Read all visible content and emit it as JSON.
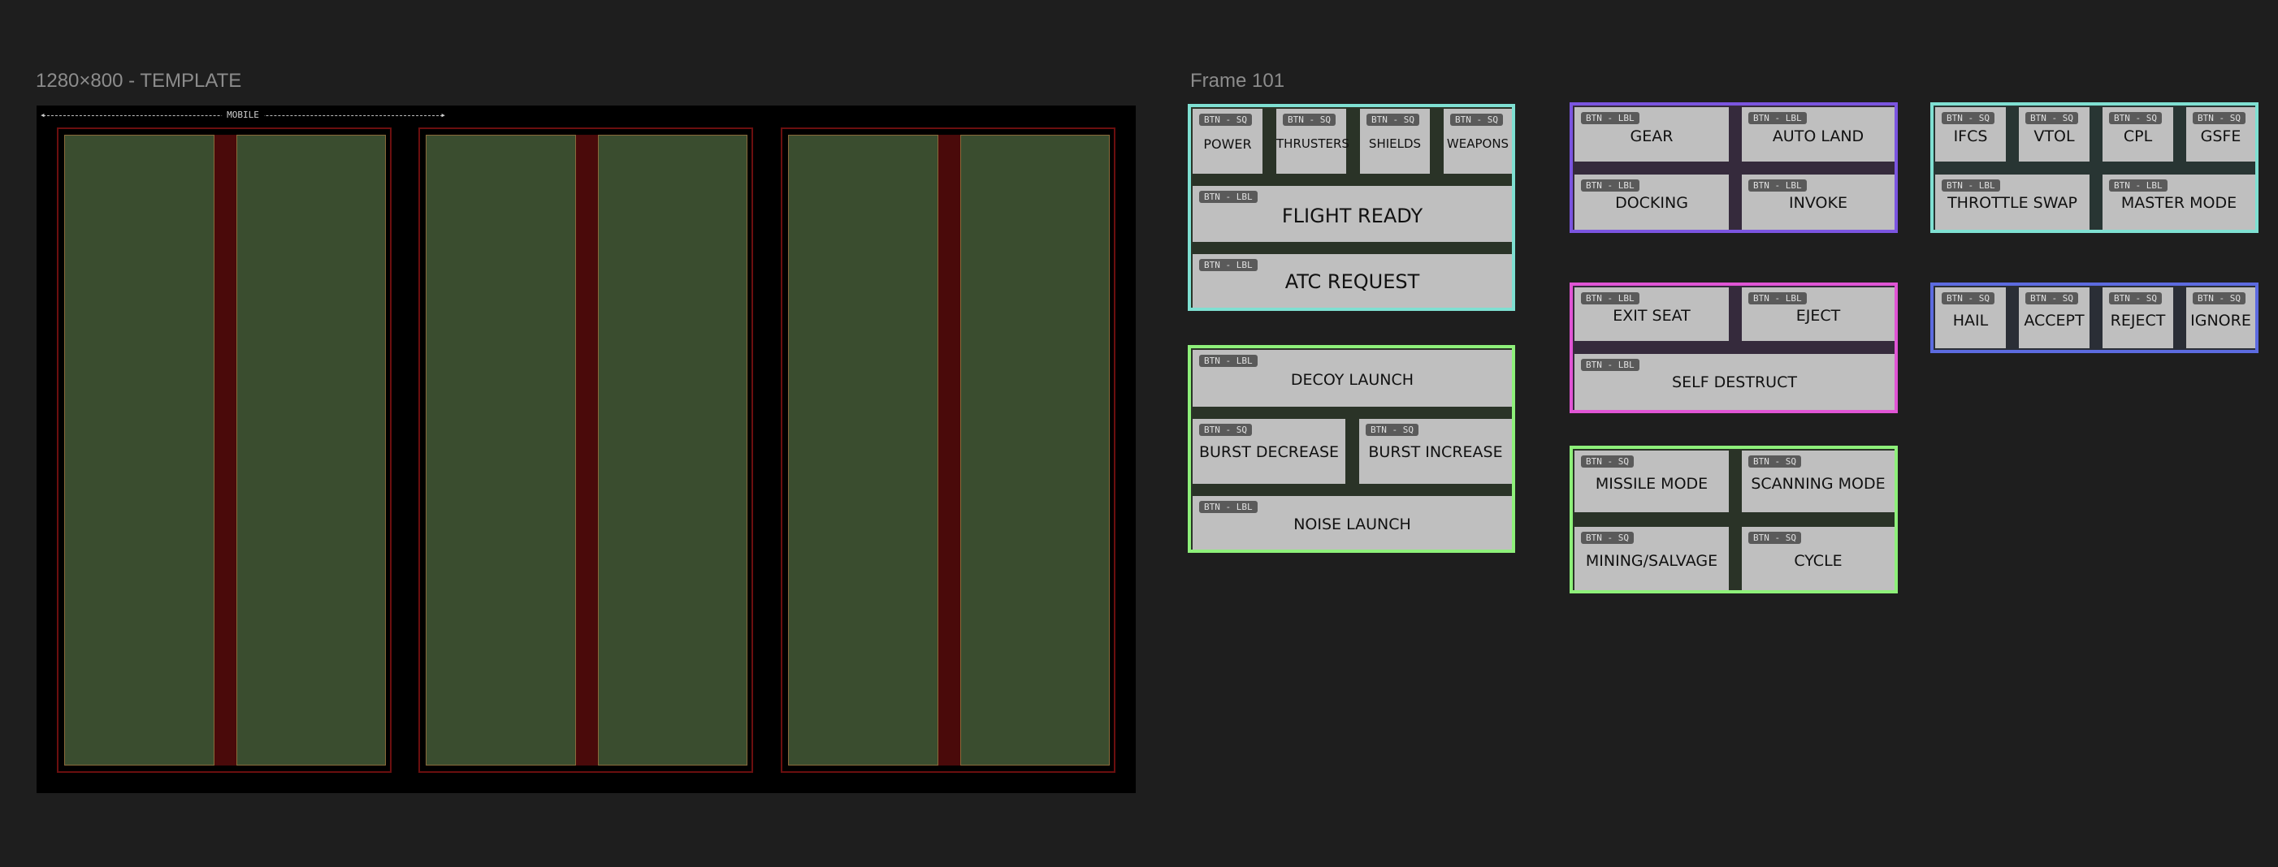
{
  "template": {
    "title": "1280×800 - TEMPLATE",
    "mobile_label": "MOBILE"
  },
  "frame101": {
    "title": "Frame 101"
  },
  "groups": {
    "flight": {
      "row1": [
        {
          "tag": "BTN - SQ",
          "label": "POWER"
        },
        {
          "tag": "BTN - SQ",
          "label": "THRUSTERS"
        },
        {
          "tag": "BTN - SQ",
          "label": "SHIELDS"
        },
        {
          "tag": "BTN - SQ",
          "label": "WEAPONS"
        }
      ],
      "flight_ready": {
        "tag": "BTN - LBL",
        "label": "FLIGHT READY"
      },
      "atc_request": {
        "tag": "BTN - LBL",
        "label": "ATC REQUEST"
      }
    },
    "countermeasures": {
      "decoy": {
        "tag": "BTN - LBL",
        "label": "DECOY LAUNCH"
      },
      "burst_decrease": {
        "tag": "BTN - SQ",
        "label": "BURST DECREASE"
      },
      "burst_increase": {
        "tag": "BTN - SQ",
        "label": "BURST INCREASE"
      },
      "noise": {
        "tag": "BTN - LBL",
        "label": "NOISE LAUNCH"
      }
    },
    "landing": {
      "gear": {
        "tag": "BTN - LBL",
        "label": "GEAR"
      },
      "auto_land": {
        "tag": "BTN - LBL",
        "label": "AUTO LAND"
      },
      "docking": {
        "tag": "BTN - LBL",
        "label": "DOCKING"
      },
      "invoke": {
        "tag": "BTN - LBL",
        "label": "INVOKE"
      }
    },
    "emergency": {
      "exit_seat": {
        "tag": "BTN - LBL",
        "label": "EXIT SEAT"
      },
      "eject": {
        "tag": "BTN - LBL",
        "label": "EJECT"
      },
      "self_destruct": {
        "tag": "BTN - LBL",
        "label": "SELF DESTRUCT"
      }
    },
    "modes": {
      "missile": {
        "tag": "BTN - SQ",
        "label": "MISSILE MODE"
      },
      "scanning": {
        "tag": "BTN - SQ",
        "label": "SCANNING MODE"
      },
      "mining": {
        "tag": "BTN - SQ",
        "label": "MINING/SALVAGE"
      },
      "cycle": {
        "tag": "BTN - SQ",
        "label": "CYCLE"
      }
    },
    "flight_systems": {
      "row1": [
        {
          "tag": "BTN - SQ",
          "label": "IFCS"
        },
        {
          "tag": "BTN - SQ",
          "label": "VTOL"
        },
        {
          "tag": "BTN - SQ",
          "label": "CPL"
        },
        {
          "tag": "BTN - SQ",
          "label": "GSFE"
        }
      ],
      "throttle_swap": {
        "tag": "BTN - LBL",
        "label": "THROTTLE SWAP"
      },
      "master_mode": {
        "tag": "BTN - LBL",
        "label": "MASTER MODE"
      }
    },
    "comms": {
      "row1": [
        {
          "tag": "BTN - SQ",
          "label": "HAIL"
        },
        {
          "tag": "BTN - SQ",
          "label": "ACCEPT"
        },
        {
          "tag": "BTN - SQ",
          "label": "REJECT"
        },
        {
          "tag": "BTN - SQ",
          "label": "IGNORE"
        }
      ]
    }
  }
}
